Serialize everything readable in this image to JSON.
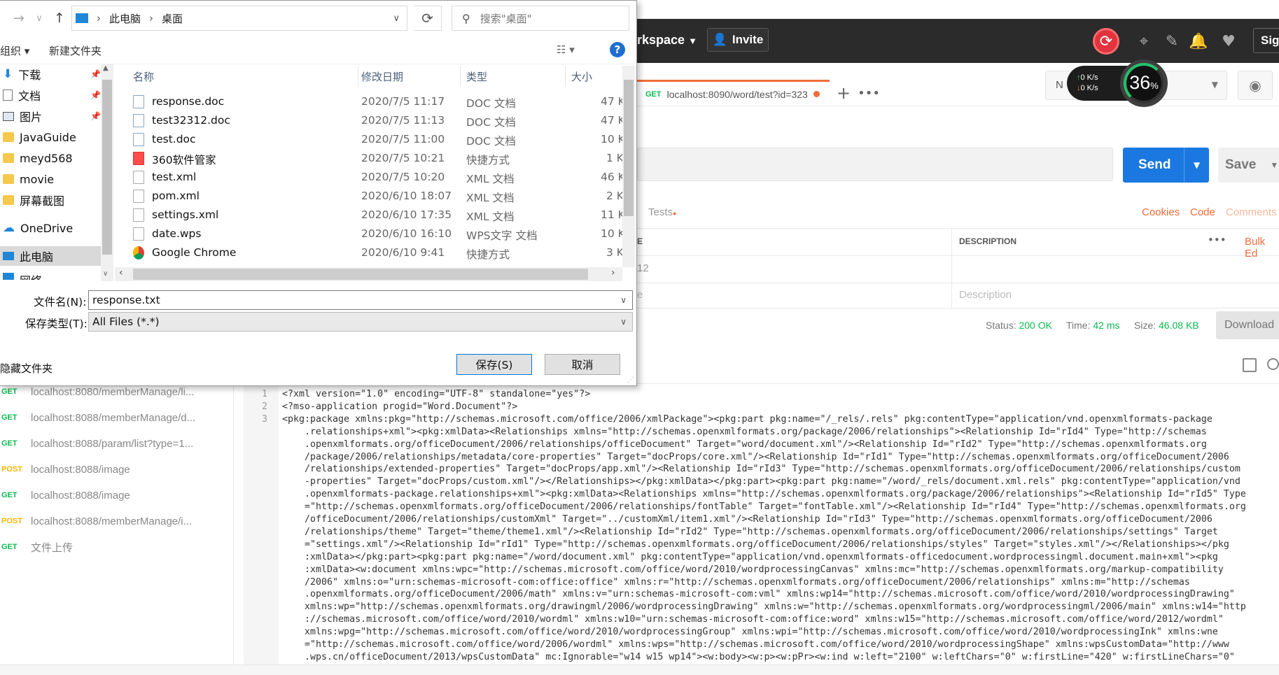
{
  "header": {
    "workspace": "rkspace",
    "invite": "Invite",
    "sign": "Sign"
  },
  "tab": {
    "method": "GET",
    "url": "localhost:8090/word/test?id=323",
    "env_prefix": "N"
  },
  "speed": {
    "up": "0 K/s",
    "down": "0 K/s",
    "percent": "36",
    "percent_unit": "%"
  },
  "request": {
    "send": "Send",
    "save": "Save",
    "tests_tab": "Tests",
    "cookies": "Cookies",
    "code": "Code",
    "comments": "Comments"
  },
  "params": {
    "col_key_fragment": "E",
    "col_description": "DESCRIPTION",
    "bulk_edit": "Bulk Ed",
    "row1_value_fragment": "12",
    "row2_key_fragment": "e",
    "description_placeholder": "Description"
  },
  "status": {
    "status_label": "Status:",
    "status_value": "200 OK",
    "time_label": "Time:",
    "time_value": "42 ms",
    "size_label": "Size:",
    "size_value": "46.08 KB",
    "download": "Download"
  },
  "history": [
    {
      "method": "GET",
      "url": "localhost:8080/memberManage/li..."
    },
    {
      "method": "GET",
      "url": "localhost:8088/memberManage/d..."
    },
    {
      "method": "GET",
      "url": "localhost:8088/param/list?type=1..."
    },
    {
      "method": "POST",
      "url": "localhost:8088/image"
    },
    {
      "method": "GET",
      "url": "localhost:8088/image"
    },
    {
      "method": "POST",
      "url": "localhost:8088/memberManage/i..."
    },
    {
      "method": "GET",
      "url": "文件上传"
    }
  ],
  "code": {
    "line_numbers": [
      "1",
      "2",
      "3"
    ],
    "lines": [
      "<?xml version=\"1.0\" encoding=\"UTF-8\" standalone=\"yes\"?>",
      "<?mso-application progid=\"Word.Document\"?>",
      "<pkg:package xmlns:pkg=\"http://schemas.microsoft.com/office/2006/xmlPackage\"><pkg:part pkg:name=\"/_rels/.rels\" pkg:contentType=\"application/vnd.openxmlformats-package",
      "    .relationships+xml\"><pkg:xmlData><Relationships xmlns=\"http://schemas.openxmlformats.org/package/2006/relationships\"><Relationship Id=\"rId4\" Type=\"http://schemas",
      "    .openxmlformats.org/officeDocument/2006/relationships/officeDocument\" Target=\"word/document.xml\"/><Relationship Id=\"rId2\" Type=\"http://schemas.openxmlformats.org",
      "    /package/2006/relationships/metadata/core-properties\" Target=\"docProps/core.xml\"/><Relationship Id=\"rId1\" Type=\"http://schemas.openxmlformats.org/officeDocument/2006",
      "    /relationships/extended-properties\" Target=\"docProps/app.xml\"/><Relationship Id=\"rId3\" Type=\"http://schemas.openxmlformats.org/officeDocument/2006/relationships/custom",
      "    -properties\" Target=\"docProps/custom.xml\"/></Relationships></pkg:xmlData></pkg:part><pkg:part pkg:name=\"/word/_rels/document.xml.rels\" pkg:contentType=\"application/vnd",
      "    .openxmlformats-package.relationships+xml\"><pkg:xmlData><Relationships xmlns=\"http://schemas.openxmlformats.org/package/2006/relationships\"><Relationship Id=\"rId5\" Type",
      "    =\"http://schemas.openxmlformats.org/officeDocument/2006/relationships/fontTable\" Target=\"fontTable.xml\"/><Relationship Id=\"rId4\" Type=\"http://schemas.openxmlformats.org",
      "    /officeDocument/2006/relationships/customXml\" Target=\"../customXml/item1.xml\"/><Relationship Id=\"rId3\" Type=\"http://schemas.openxmlformats.org/officeDocument/2006",
      "    /relationships/theme\" Target=\"theme/theme1.xml\"/><Relationship Id=\"rId2\" Type=\"http://schemas.openxmlformats.org/officeDocument/2006/relationships/settings\" Target",
      "    =\"settings.xml\"/><Relationship Id=\"rId1\" Type=\"http://schemas.openxmlformats.org/officeDocument/2006/relationships/styles\" Target=\"styles.xml\"/></Relationships></pkg",
      "    :xmlData></pkg:part><pkg:part pkg:name=\"/word/document.xml\" pkg:contentType=\"application/vnd.openxmlformats-officedocument.wordprocessingml.document.main+xml\"><pkg",
      "    :xmlData><w:document xmlns:wpc=\"http://schemas.microsoft.com/office/word/2010/wordprocessingCanvas\" xmlns:mc=\"http://schemas.openxmlformats.org/markup-compatibility",
      "    /2006\" xmlns:o=\"urn:schemas-microsoft-com:office:office\" xmlns:r=\"http://schemas.openxmlformats.org/officeDocument/2006/relationships\" xmlns:m=\"http://schemas",
      "    .openxmlformats.org/officeDocument/2006/math\" xmlns:v=\"urn:schemas-microsoft-com:vml\" xmlns:wp14=\"http://schemas.microsoft.com/office/word/2010/wordprocessingDrawing\"",
      "    xmlns:wp=\"http://schemas.openxmlformats.org/drawingml/2006/wordprocessingDrawing\" xmlns:w=\"http://schemas.openxmlformats.org/wordprocessingml/2006/main\" xmlns:w14=\"http",
      "    ://schemas.microsoft.com/office/word/2010/wordml\" xmlns:w10=\"urn:schemas-microsoft-com:office:word\" xmlns:w15=\"http://schemas.microsoft.com/office/word/2012/wordml\"",
      "    xmlns:wpg=\"http://schemas.microsoft.com/office/word/2010/wordprocessingGroup\" xmlns:wpi=\"http://schemas.microsoft.com/office/word/2010/wordprocessingInk\" xmlns:wne",
      "    =\"http://schemas.microsoft.com/office/word/2006/wordml\" xmlns:wps=\"http://schemas.microsoft.com/office/word/2010/wordprocessingShape\" xmlns:wpsCustomData=\"http://www",
      "    .wps.cn/officeDocument/2013/wpsCustomData\" mc:Ignorable=\"w14 w15 wp14\"><w:body><w:p><w:pPr><w:ind w:left=\"2100\" w:leftChars=\"0\" w:firstLine=\"420\" w:firstLineChars=\"0\""
    ]
  },
  "dialog": {
    "breadcrumb": [
      "此电脑",
      "桌面"
    ],
    "search_placeholder": "搜索\"桌面\"",
    "organize": "组织 ▾",
    "new_folder": "新建文件夹",
    "nav": [
      {
        "label": "下载",
        "icon": "download-arrow-icon"
      },
      {
        "label": "文档",
        "icon": "document-icon"
      },
      {
        "label": "图片",
        "icon": "picture-icon"
      },
      {
        "label": "JavaGuide",
        "icon": "folder-icon"
      },
      {
        "label": "meyd568",
        "icon": "folder-icon"
      },
      {
        "label": "movie",
        "icon": "folder-icon"
      },
      {
        "label": "屏幕截图",
        "icon": "folder-icon"
      },
      {
        "label": "OneDrive",
        "icon": "cloud-icon"
      },
      {
        "label": "此电脑",
        "icon": "computer-icon"
      },
      {
        "label": "网络",
        "icon": "network-icon"
      }
    ],
    "columns": {
      "name": "名称",
      "modified": "修改日期",
      "type": "类型",
      "size": "大小"
    },
    "files": [
      {
        "name": "response.doc",
        "date": "2020/7/5 11:17",
        "type": "DOC 文档",
        "size": "47 K",
        "icon": "doc"
      },
      {
        "name": "test32312.doc",
        "date": "2020/7/5 11:13",
        "type": "DOC 文档",
        "size": "47 K",
        "icon": "doc"
      },
      {
        "name": "test.doc",
        "date": "2020/7/5 11:00",
        "type": "DOC 文档",
        "size": "10 K",
        "icon": "doc"
      },
      {
        "name": "360软件管家",
        "date": "2020/7/5 10:21",
        "type": "快捷方式",
        "size": "1 K",
        "icon": "lnk"
      },
      {
        "name": "test.xml",
        "date": "2020/7/5 10:20",
        "type": "XML 文档",
        "size": "46 K",
        "icon": "xml"
      },
      {
        "name": "pom.xml",
        "date": "2020/6/10 18:07",
        "type": "XML 文档",
        "size": "2 K",
        "icon": "xml"
      },
      {
        "name": "settings.xml",
        "date": "2020/6/10 17:35",
        "type": "XML 文档",
        "size": "11 K",
        "icon": "xml"
      },
      {
        "name": "date.wps",
        "date": "2020/6/10 16:10",
        "type": "WPS文字 文档",
        "size": "10 K",
        "icon": "xml"
      },
      {
        "name": "Google Chrome",
        "date": "2020/6/10 9:41",
        "type": "快捷方式",
        "size": "3 K",
        "icon": "chrome"
      }
    ],
    "filename_label": "文件名(N):",
    "filename_value": "response.txt",
    "filetype_label": "保存类型(T):",
    "filetype_value": "All Files (*.*)",
    "hide_folders": "隐藏文件夹",
    "save": "保存(S)",
    "cancel": "取消"
  }
}
